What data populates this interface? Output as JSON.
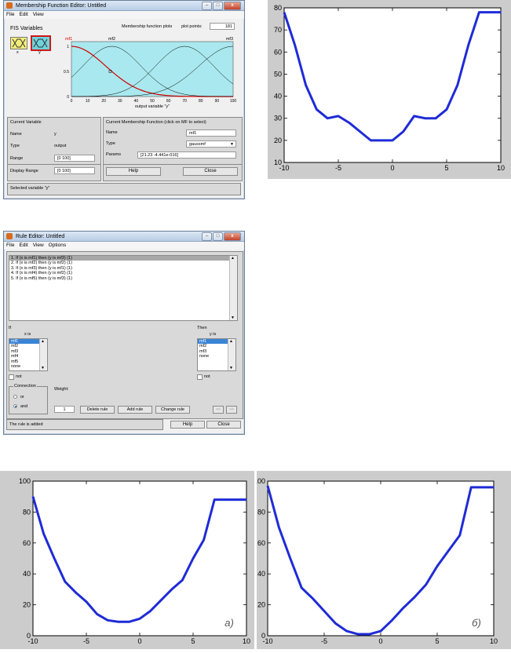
{
  "mf_editor": {
    "title": "Membership Function Editor: Untitled",
    "menu": [
      "File",
      "Edit",
      "View"
    ],
    "fis_variables_label": "FIS Variables",
    "var_x": "x",
    "var_y": "y",
    "plot_title": "Membership function plots",
    "plot_points_label": "plot points:",
    "plot_points_value": "181",
    "mf_names": [
      "mf1",
      "mf2",
      "mf3"
    ],
    "xaxis_label": "output variable \"y\"",
    "x_ticks": [
      "0",
      "10",
      "20",
      "30",
      "40",
      "50",
      "60",
      "70",
      "80",
      "90",
      "100"
    ],
    "y_ticks": [
      "0",
      "0.5",
      "1"
    ],
    "current_variable_title": "Current Variable",
    "name_label": "Name",
    "name_value": "y",
    "type_label": "Type",
    "type_value": "output",
    "range_label": "Range",
    "range_value": "[0 100]",
    "display_range_label": "Display Range",
    "display_range_value": "[0 100]",
    "current_mf_title": "Current Membership Function (click on MF to select)",
    "mf_name_label": "Name",
    "mf_name_value": "mf1",
    "mf_type_label": "Type",
    "mf_type_value": "gaussmf",
    "params_label": "Params",
    "params_value": "[21.23 -4.441e-016]",
    "help_button": "Help",
    "close_button": "Close",
    "status": "Selected variable \"y\""
  },
  "rule_editor": {
    "title": "Rule Editor: Untitled",
    "menu": [
      "File",
      "Edit",
      "View",
      "Options"
    ],
    "rules": [
      "1. If (x is mf1) then (y is mf3) (1)",
      "2. If (x is mf2) then (y is mf2) (1)",
      "3. If (x is mf3) then (y is mf1) (1)",
      "4. If (x is mf4) then (y is mf2) (1)",
      "5. If (x is mf5) then (y is mf3) (1)"
    ],
    "if_label": "If",
    "x_is_label": "x is",
    "x_options": [
      "mf1",
      "mf2",
      "mf3",
      "mf4",
      "mf5",
      "none"
    ],
    "then_label": "Then",
    "y_is_label": "y is",
    "y_options": [
      "mf1",
      "mf2",
      "mf3",
      "none"
    ],
    "not_label": "not",
    "connection_label": "Connection",
    "or_label": "or",
    "and_label": "and",
    "weight_label": "Weight:",
    "weight_value": "1",
    "delete_rule": "Delete rule",
    "add_rule": "Add rule",
    "change_rule": "Change rule",
    "nav_prev": "<<",
    "nav_next": ">>",
    "status": "The rule is added",
    "help_button": "Help",
    "close_button": "Close"
  },
  "panel_labels": [
    "а)",
    "б)"
  ],
  "chart_data": [
    {
      "type": "line",
      "x": [
        -10,
        -9,
        -8,
        -7,
        -6,
        -5,
        -4,
        -3,
        -2,
        -1,
        0,
        1,
        2,
        3,
        4,
        5,
        6,
        7,
        8,
        9,
        10
      ],
      "values": [
        78,
        63,
        45,
        34,
        30,
        31,
        28,
        24,
        20,
        20,
        20,
        24,
        31,
        30,
        30,
        34,
        45,
        63,
        78,
        78,
        78
      ],
      "xlim": [
        -10,
        10
      ],
      "ylim": [
        10,
        80
      ],
      "x_ticks": [
        -10,
        -5,
        0,
        5,
        10
      ],
      "y_ticks": [
        10,
        20,
        30,
        40,
        50,
        60,
        70,
        80
      ],
      "color": "#1f2bd6"
    },
    {
      "type": "line",
      "x": [
        -10,
        -9,
        -8,
        -7,
        -6,
        -5,
        -4,
        -3,
        -2,
        -1,
        0,
        1,
        2,
        3,
        4,
        5,
        6,
        7,
        8,
        9,
        10
      ],
      "values": [
        90,
        66,
        50,
        35,
        28,
        22,
        14,
        10,
        9,
        9,
        11,
        16,
        23,
        30,
        36,
        50,
        62,
        88,
        88,
        88,
        88
      ],
      "xlim": [
        -10,
        10
      ],
      "ylim": [
        0,
        100
      ],
      "x_ticks": [
        -10,
        -5,
        0,
        5,
        10
      ],
      "y_ticks": [
        0,
        20,
        40,
        60,
        80,
        100
      ],
      "color": "#1f2bd6"
    },
    {
      "type": "line",
      "x": [
        -10,
        -9,
        -8,
        -7,
        -6,
        -5,
        -4,
        -3,
        -2,
        -1,
        0,
        1,
        2,
        3,
        4,
        5,
        6,
        7,
        8,
        9,
        10
      ],
      "values": [
        97,
        70,
        50,
        31,
        24,
        16,
        8,
        3,
        1,
        1,
        3,
        10,
        18,
        25,
        33,
        45,
        55,
        65,
        96,
        96,
        96
      ],
      "xlim": [
        -10,
        10
      ],
      "ylim": [
        0,
        100
      ],
      "x_ticks": [
        -10,
        -5,
        0,
        5,
        10
      ],
      "y_ticks": [
        0,
        20,
        40,
        60,
        80,
        100
      ],
      "color": "#1f2bd6"
    }
  ]
}
